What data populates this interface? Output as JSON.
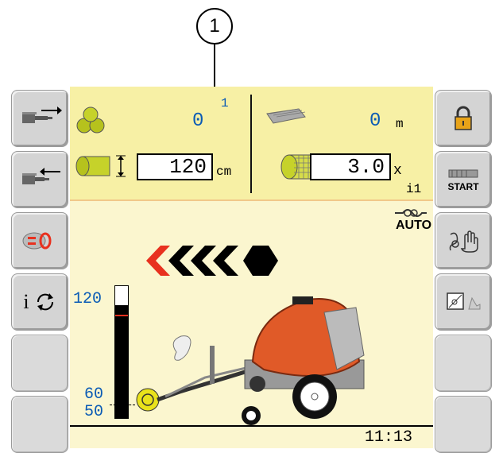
{
  "callout": {
    "number": "1"
  },
  "left_softkeys": [
    {
      "name": "extend-icon"
    },
    {
      "name": "retract-icon"
    },
    {
      "name": "reset-counter-icon"
    },
    {
      "name": "info-cycle-icon",
      "label": "i"
    },
    {
      "name": "empty"
    },
    {
      "name": "empty"
    }
  ],
  "right_softkeys": [
    {
      "name": "lock-icon"
    },
    {
      "name": "start-wrap-icon",
      "label": "START"
    },
    {
      "name": "manual-auto-icon"
    },
    {
      "name": "view-toggle-icon"
    },
    {
      "name": "empty"
    },
    {
      "name": "empty"
    }
  ],
  "counters": {
    "bales_value": "0",
    "bales_index": "1",
    "net_length_value": "0",
    "net_length_unit": "m",
    "bale_diameter_value": "120",
    "bale_diameter_unit": "cm",
    "wraps_value": "3.0",
    "wraps_unit": "x",
    "preset_label": "i1"
  },
  "knotter": {
    "mode_label": "AUTO"
  },
  "direction_arrows": {
    "count": 5,
    "highlight_color": "#e8311f"
  },
  "fill_gauge": {
    "top_label": "120",
    "mid_label": "60",
    "bottom_label": "50",
    "max": 120,
    "min": 50,
    "current": 120,
    "target": 115
  },
  "status": {
    "time": "11:13"
  },
  "colors": {
    "accent": "#0b5bb5",
    "machine": "#e05a28",
    "warning": "#e8311f"
  }
}
